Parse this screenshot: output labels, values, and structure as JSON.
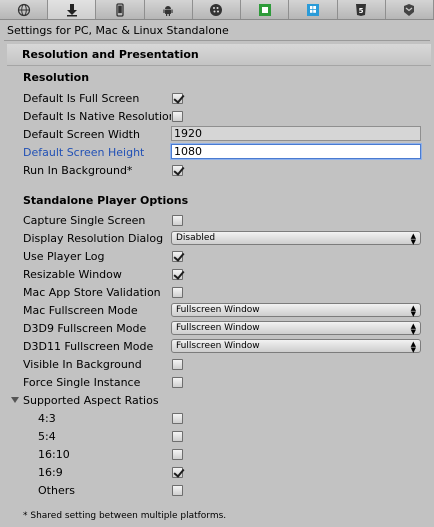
{
  "platform_tabs": [
    {
      "name": "web",
      "icon": "globe-icon",
      "active": false
    },
    {
      "name": "standalone",
      "icon": "download-arrow-icon",
      "active": true
    },
    {
      "name": "ios",
      "icon": "phone-icon",
      "active": false
    },
    {
      "name": "android",
      "icon": "android-icon",
      "active": false
    },
    {
      "name": "blackberry",
      "icon": "blackberry-icon",
      "active": false
    },
    {
      "name": "windows-store",
      "icon": "windows-store-icon",
      "active": false
    },
    {
      "name": "windows-phone",
      "icon": "windows-phone-icon",
      "active": false
    },
    {
      "name": "html5",
      "icon": "html5-icon",
      "active": false
    },
    {
      "name": "other",
      "icon": "shield-icon",
      "active": false
    }
  ],
  "settings_title": "Settings for PC, Mac & Linux Standalone",
  "section_title": "Resolution and Presentation",
  "resolution": {
    "heading": "Resolution",
    "default_full_screen_label": "Default Is Full Screen",
    "default_full_screen": true,
    "native_resolution_label": "Default Is Native Resolution",
    "native_resolution": false,
    "screen_width_label": "Default Screen Width",
    "screen_width": "1920",
    "screen_height_label": "Default Screen Height",
    "screen_height": "1080",
    "run_in_background_label": "Run In Background*",
    "run_in_background": true
  },
  "standalone": {
    "heading": "Standalone Player Options",
    "capture_single_screen_label": "Capture Single Screen",
    "capture_single_screen": false,
    "display_resolution_dialog_label": "Display Resolution Dialog",
    "display_resolution_dialog": "Disabled",
    "use_player_log_label": "Use Player Log",
    "use_player_log": true,
    "resizable_window_label": "Resizable Window",
    "resizable_window": true,
    "mac_app_store_label": "Mac App Store Validation",
    "mac_app_store": false,
    "mac_fullscreen_mode_label": "Mac Fullscreen Mode",
    "mac_fullscreen_mode": "Fullscreen Window",
    "d3d9_fullscreen_mode_label": "D3D9 Fullscreen Mode",
    "d3d9_fullscreen_mode": "Fullscreen Window",
    "d3d11_fullscreen_mode_label": "D3D11 Fullscreen Mode",
    "d3d11_fullscreen_mode": "Fullscreen Window",
    "visible_in_background_label": "Visible In Background",
    "visible_in_background": false,
    "force_single_instance_label": "Force Single Instance",
    "force_single_instance": false
  },
  "aspect_ratios": {
    "heading": "Supported Aspect Ratios",
    "items": [
      {
        "label": "4:3",
        "checked": false
      },
      {
        "label": "5:4",
        "checked": false
      },
      {
        "label": "16:10",
        "checked": false
      },
      {
        "label": "16:9",
        "checked": true
      },
      {
        "label": "Others",
        "checked": false
      }
    ]
  },
  "footnote": "* Shared setting between multiple platforms."
}
